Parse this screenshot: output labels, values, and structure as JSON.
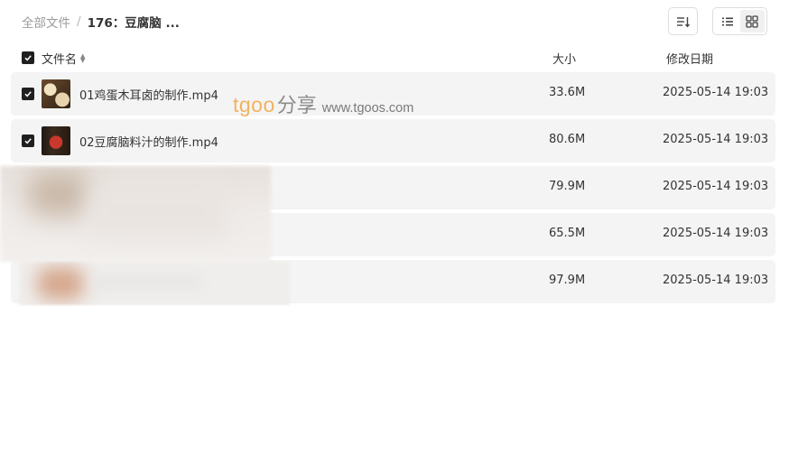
{
  "breadcrumb": {
    "root": "全部文件",
    "separator": "/",
    "current": "176：豆腐脑 ..."
  },
  "toolbar": {
    "sort_icon": "sort-lines-icon",
    "view_list_icon": "list-view-icon",
    "view_grid_icon": "grid-view-icon"
  },
  "table": {
    "columns": {
      "name": "文件名",
      "size": "大小",
      "date": "修改日期"
    },
    "rows": [
      {
        "name": "01鸡蛋木耳卤的制作.mp4",
        "size": "33.6M",
        "date": "2025-05-14 19:03",
        "checked": true
      },
      {
        "name": "02豆腐脑料汁的制作.mp4",
        "size": "80.6M",
        "date": "2025-05-14 19:03",
        "checked": true
      },
      {
        "name": "",
        "size": "79.9M",
        "date": "2025-05-14 19:03",
        "checked": false
      },
      {
        "name": "",
        "size": "65.5M",
        "date": "2025-05-14 19:03",
        "checked": false
      },
      {
        "name": "",
        "size": "97.9M",
        "date": "2025-05-14 19:03",
        "checked": false
      }
    ]
  },
  "watermark": {
    "brand": "tgoo",
    "share": "分享",
    "url": "www.tgoos.com"
  },
  "colors": {
    "row_background": "#f4f4f4",
    "checkbox": "#1f1f1f",
    "watermark_brand": "#f2b25f"
  }
}
